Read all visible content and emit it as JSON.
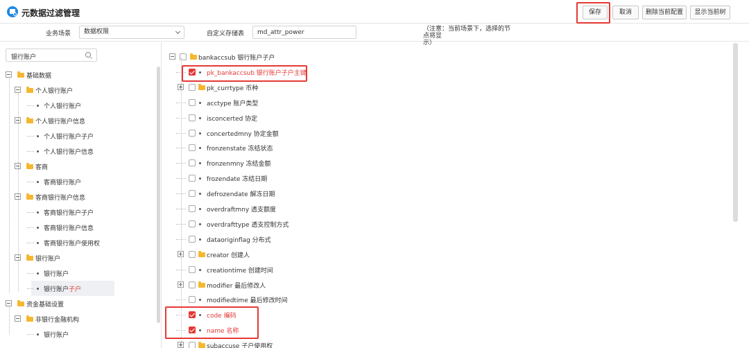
{
  "app": {
    "title": "元数据过滤管理"
  },
  "toolbar": {
    "save": "保存",
    "cancel": "取消",
    "delete_config": "删除当前配置",
    "show_tree": "显示当前树"
  },
  "form": {
    "scene_label": "业务场景",
    "scene_value": "数据权限",
    "table_label": "自定义存储表",
    "table_value": "md_attr_power",
    "note_line1": "（注意：当前场景下，选择的节点将显",
    "note_line2": "示）"
  },
  "left_search": {
    "value": "银行账户"
  },
  "left_tree": [
    {
      "label": "基础数据",
      "level": 0,
      "type": "folder",
      "expanded": true
    },
    {
      "label": "个人银行账户",
      "level": 1,
      "type": "folder",
      "expanded": true
    },
    {
      "label": "个人银行账户",
      "level": 2,
      "type": "leaf"
    },
    {
      "label": "个人银行账户信息",
      "level": 1,
      "type": "folder",
      "expanded": true
    },
    {
      "label": "个人银行账户子户",
      "level": 2,
      "type": "leaf"
    },
    {
      "label": "个人银行账户信息",
      "level": 2,
      "type": "leaf"
    },
    {
      "label": "客商",
      "level": 1,
      "type": "folder",
      "expanded": true
    },
    {
      "label": "客商银行账户",
      "level": 2,
      "type": "leaf"
    },
    {
      "label": "客商银行账户信息",
      "level": 1,
      "type": "folder",
      "expanded": true
    },
    {
      "label": "客商银行账户子户",
      "level": 2,
      "type": "leaf"
    },
    {
      "label": "客商银行账户信息",
      "level": 2,
      "type": "leaf"
    },
    {
      "label": "客商银行账户使用权",
      "level": 2,
      "type": "leaf"
    },
    {
      "label": "银行账户",
      "level": 1,
      "type": "folder",
      "expanded": true
    },
    {
      "label": "银行账户",
      "level": 2,
      "type": "leaf"
    },
    {
      "label": "银行账户",
      "highlight": "子户",
      "level": 2,
      "type": "leaf",
      "selected": true
    },
    {
      "label": "资金基础设置",
      "level": 0,
      "type": "folder",
      "expanded": true
    },
    {
      "label": "非银行金融机构",
      "level": 1,
      "type": "folder",
      "expanded": true
    },
    {
      "label": "银行账户",
      "level": 2,
      "type": "leaf"
    }
  ],
  "right_tree": [
    {
      "label": "bankaccsub 银行账户子户",
      "level": 0,
      "type": "folder",
      "pm": "minus",
      "checked": false
    },
    {
      "label": "pk_bankaccsub 银行账户子户主键",
      "level": 1,
      "type": "leaf",
      "checked": true,
      "red": true
    },
    {
      "label": "pk_currtype 币种",
      "level": 1,
      "type": "folder",
      "pm": "plus",
      "checked": false
    },
    {
      "label": "acctype 账户类型",
      "level": 1,
      "type": "leaf",
      "checked": false
    },
    {
      "label": "isconcerted 协定",
      "level": 1,
      "type": "leaf",
      "checked": false
    },
    {
      "label": "concertedmny 协定金额",
      "level": 1,
      "type": "leaf",
      "checked": false
    },
    {
      "label": "fronzenstate 冻结状态",
      "level": 1,
      "type": "leaf",
      "checked": false
    },
    {
      "label": "fronzenmny 冻结金额",
      "level": 1,
      "type": "leaf",
      "checked": false
    },
    {
      "label": "frozendate 冻结日期",
      "level": 1,
      "type": "leaf",
      "checked": false
    },
    {
      "label": "defrozendate 解冻日期",
      "level": 1,
      "type": "leaf",
      "checked": false
    },
    {
      "label": "overdraftmny 透支额度",
      "level": 1,
      "type": "leaf",
      "checked": false
    },
    {
      "label": "overdrafttype 透支控制方式",
      "level": 1,
      "type": "leaf",
      "checked": false
    },
    {
      "label": "dataoriginflag 分布式",
      "level": 1,
      "type": "leaf",
      "checked": false
    },
    {
      "label": "creator 创建人",
      "level": 1,
      "type": "folder",
      "pm": "plus",
      "checked": false
    },
    {
      "label": "creationtime 创建时间",
      "level": 1,
      "type": "leaf",
      "checked": false
    },
    {
      "label": "modifier 最后修改人",
      "level": 1,
      "type": "folder",
      "pm": "plus",
      "checked": false
    },
    {
      "label": "modifiedtime 最后修改时间",
      "level": 1,
      "type": "leaf",
      "checked": false
    },
    {
      "label": "code 编码",
      "level": 1,
      "type": "leaf",
      "checked": true,
      "red": true
    },
    {
      "label": "name 名称",
      "level": 1,
      "type": "leaf",
      "checked": true,
      "red": true
    },
    {
      "label": "subaccuse 子户使用权",
      "level": 1,
      "type": "folder",
      "pm": "plus",
      "checked": false
    }
  ]
}
